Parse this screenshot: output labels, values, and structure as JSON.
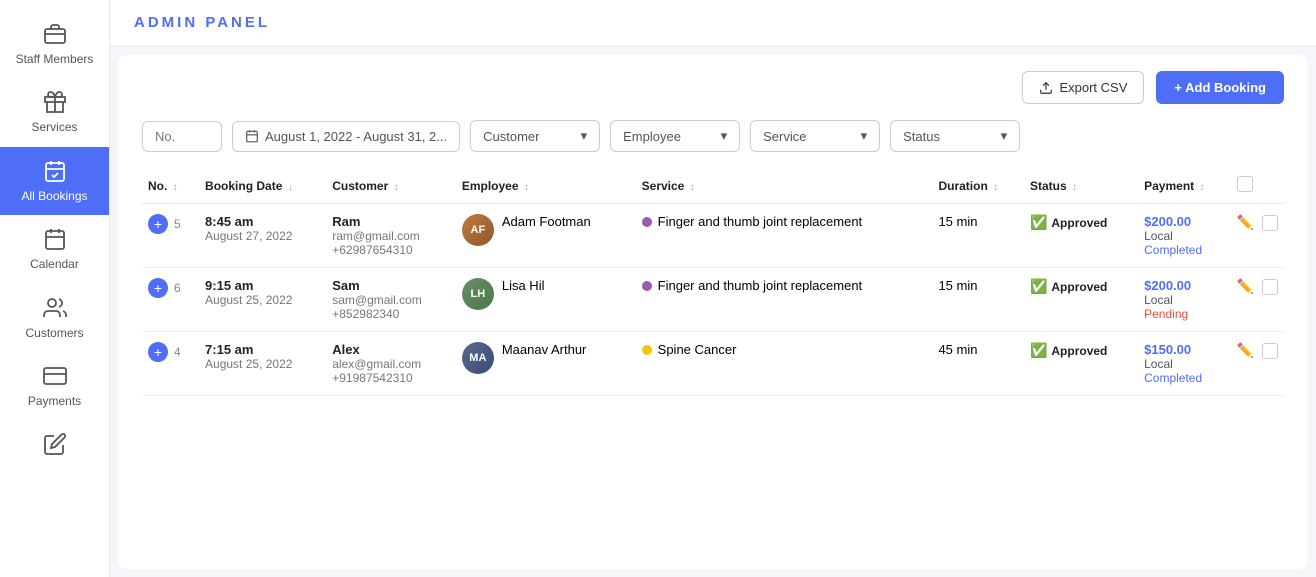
{
  "header": {
    "title": "ADMIN PANEL"
  },
  "sidebar": {
    "items": [
      {
        "id": "staff-members",
        "label": "Staff Members",
        "icon": "briefcase"
      },
      {
        "id": "services",
        "label": "Services",
        "icon": "gift"
      },
      {
        "id": "all-bookings",
        "label": "All Bookings",
        "icon": "calendar-check",
        "active": true
      },
      {
        "id": "calendar",
        "label": "Calendar",
        "icon": "calendar"
      },
      {
        "id": "customers",
        "label": "Customers",
        "icon": "users"
      },
      {
        "id": "payments",
        "label": "Payments",
        "icon": "credit-card"
      },
      {
        "id": "edit",
        "label": "",
        "icon": "edit"
      }
    ]
  },
  "toolbar": {
    "export_label": "Export CSV",
    "add_label": "+ Add Booking"
  },
  "filters": {
    "no_placeholder": "No.",
    "date_value": "August 1, 2022 - August 31, 2...",
    "customer_label": "Customer",
    "employee_label": "Employee",
    "service_label": "Service",
    "status_label": "Status"
  },
  "table": {
    "columns": [
      "No.",
      "Booking Date",
      "Customer",
      "Employee",
      "Service",
      "Duration",
      "Status",
      "Payment"
    ],
    "rows": [
      {
        "expand": "+",
        "no": "5",
        "time": "8:45 am",
        "date": "August 27, 2022",
        "customer_name": "Ram",
        "customer_email": "ram@gmail.com",
        "customer_phone": "+62987654310",
        "employee_name": "Adam Footman",
        "employee_avatar": "AF",
        "employee_avatar_class": "avatar-adam",
        "service_name": "Finger and thumb joint replacement",
        "service_dot": "dot-purple",
        "duration": "15 min",
        "status": "Approved",
        "payment_amount": "$200.00",
        "payment_type": "Local",
        "payment_status": "Completed",
        "payment_status_class": "payment-status-completed"
      },
      {
        "expand": "+",
        "no": "6",
        "time": "9:15 am",
        "date": "August 25, 2022",
        "customer_name": "Sam",
        "customer_email": "sam@gmail.com",
        "customer_phone": "+852982340",
        "employee_name": "Lisa Hil",
        "employee_avatar": "LH",
        "employee_avatar_class": "avatar-lisa",
        "service_name": "Finger and thumb joint replacement",
        "service_dot": "dot-purple",
        "duration": "15 min",
        "status": "Approved",
        "payment_amount": "$200.00",
        "payment_type": "Local",
        "payment_status": "Pending",
        "payment_status_class": "payment-status-pending"
      },
      {
        "expand": "+",
        "no": "4",
        "time": "7:15 am",
        "date": "August 25, 2022",
        "customer_name": "Alex",
        "customer_email": "alex@gmail.com",
        "customer_phone": "+91987542310",
        "employee_name": "Maanav Arthur",
        "employee_avatar": "MA",
        "employee_avatar_class": "avatar-maanav",
        "service_name": "Spine Cancer",
        "service_dot": "dot-yellow",
        "duration": "45 min",
        "status": "Approved",
        "payment_amount": "$150.00",
        "payment_type": "Local",
        "payment_status": "Completed",
        "payment_status_class": "payment-status-completed"
      }
    ]
  }
}
